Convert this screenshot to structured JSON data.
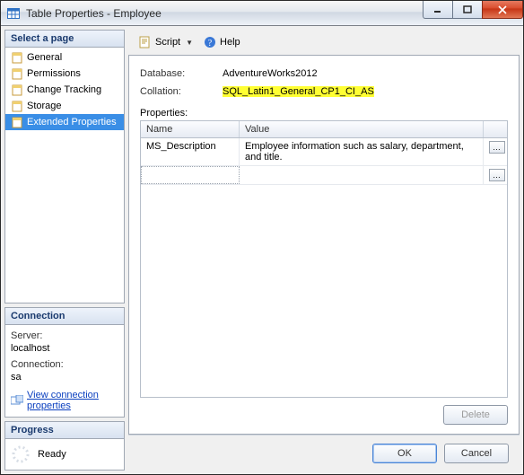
{
  "titlebar": {
    "title": "Table Properties - Employee"
  },
  "sidebar": {
    "select_page_header": "Select a page",
    "items": [
      {
        "label": "General",
        "selected": false
      },
      {
        "label": "Permissions",
        "selected": false
      },
      {
        "label": "Change Tracking",
        "selected": false
      },
      {
        "label": "Storage",
        "selected": false
      },
      {
        "label": "Extended Properties",
        "selected": true
      }
    ]
  },
  "connection": {
    "header": "Connection",
    "server_label": "Server:",
    "server_value": "localhost",
    "connection_label": "Connection:",
    "connection_value": "sa",
    "view_props_link": "View connection properties"
  },
  "progress": {
    "header": "Progress",
    "status": "Ready"
  },
  "toolbar": {
    "script_label": "Script",
    "help_label": "Help"
  },
  "main": {
    "database_label": "Database:",
    "database_value": "AdventureWorks2012",
    "collation_label": "Collation:",
    "collation_value": "SQL_Latin1_General_CP1_CI_AS",
    "properties_label": "Properties:",
    "grid": {
      "col_name": "Name",
      "col_value": "Value",
      "rows": [
        {
          "name": "MS_Description",
          "value": "Employee information such as salary, department, and title."
        }
      ]
    },
    "delete_button": "Delete"
  },
  "footer": {
    "ok": "OK",
    "cancel": "Cancel"
  }
}
